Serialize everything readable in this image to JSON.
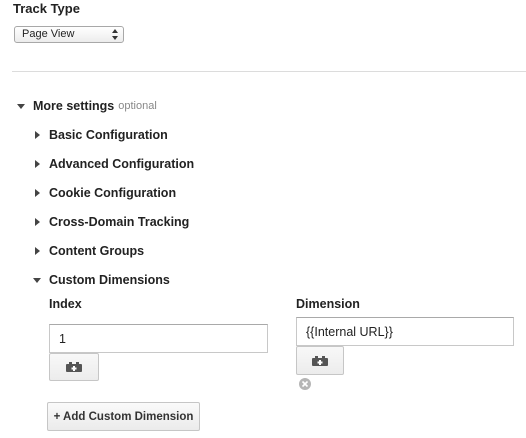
{
  "track_type": {
    "label": "Track Type",
    "selected": "Page View"
  },
  "more_settings": {
    "label": "More settings",
    "optional_label": "optional",
    "sections": [
      {
        "label": "Basic Configuration",
        "expanded": false
      },
      {
        "label": "Advanced Configuration",
        "expanded": false
      },
      {
        "label": "Cookie Configuration",
        "expanded": false
      },
      {
        "label": "Cross-Domain Tracking",
        "expanded": false
      },
      {
        "label": "Content Groups",
        "expanded": false
      },
      {
        "label": "Custom Dimensions",
        "expanded": true
      }
    ]
  },
  "custom_dimensions": {
    "index_header": "Index",
    "dimension_header": "Dimension",
    "rows": [
      {
        "index": "1",
        "dimension": "{{Internal URL}}"
      }
    ],
    "add_button_label": "+ Add Custom Dimension"
  },
  "icons": {
    "variable_picker": "variable-picker-icon",
    "remove": "remove-icon",
    "select_arrows": "select-arrows-icon"
  },
  "colors": {
    "text": "#222222",
    "muted": "#888888",
    "border": "#c8c8c8",
    "divider": "#dcdcdc"
  }
}
